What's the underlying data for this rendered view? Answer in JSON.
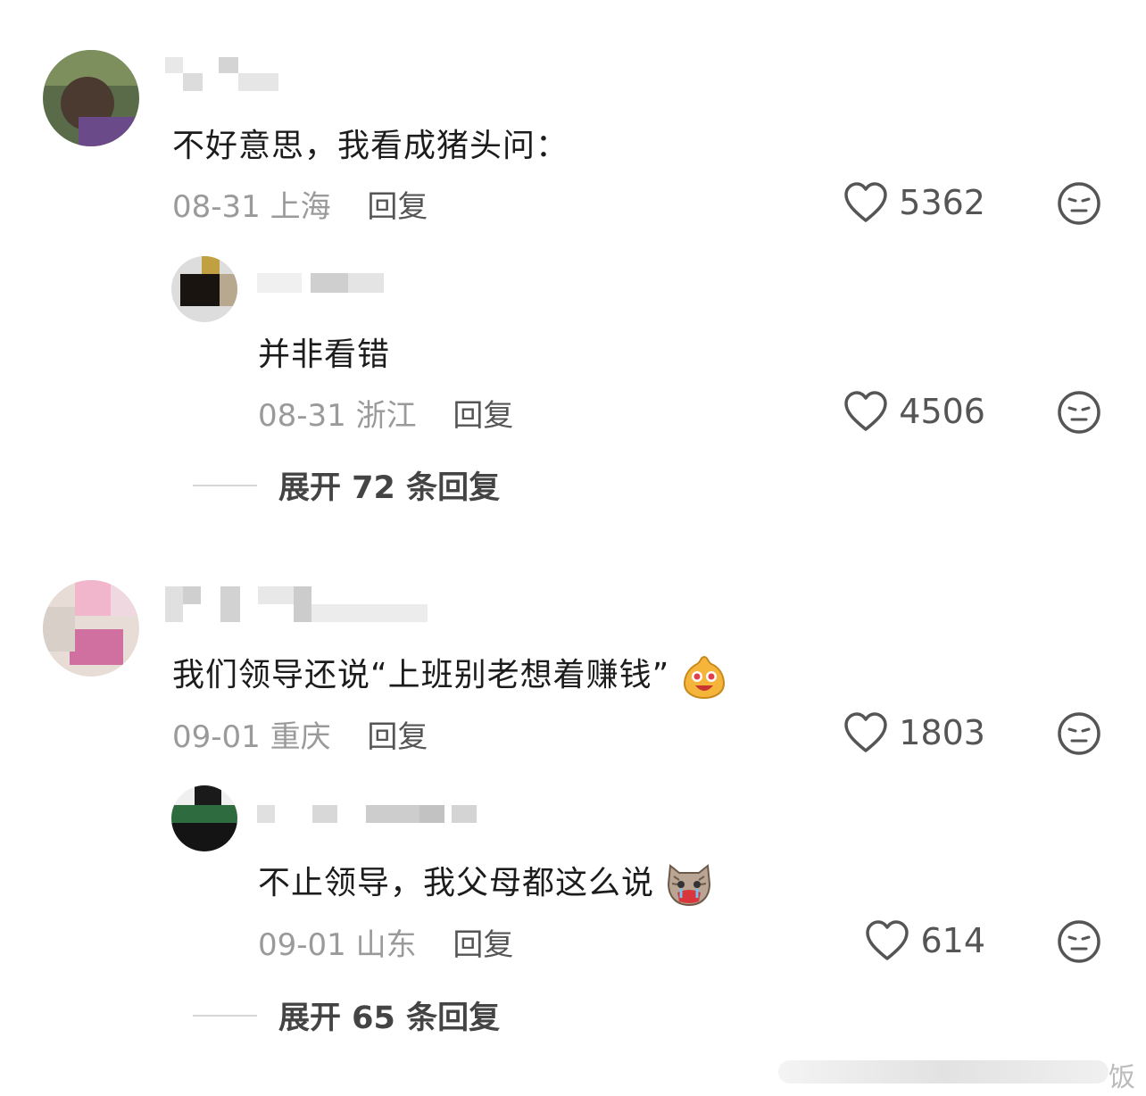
{
  "comments": [
    {
      "text": "不好意思，我看成猪头问：",
      "date": "08-31",
      "location": "上海",
      "reply_label": "回复",
      "likes": "5362",
      "reply": {
        "text": "并非看错",
        "date": "08-31",
        "location": "浙江",
        "reply_label": "回复",
        "likes": "4506"
      },
      "expand_label": "展开 72 条回复"
    },
    {
      "text": "我们领导还说“上班别老想着赚钱”",
      "emoji": "happy-face-emoji",
      "date": "09-01",
      "location": "重庆",
      "reply_label": "回复",
      "likes": "1803",
      "reply": {
        "text": "不止领导，我父母都这么说",
        "emoji": "crying-cat-emoji",
        "date": "09-01",
        "location": "山东",
        "reply_label": "回复",
        "likes": "614"
      },
      "expand_label": "展开 65 条回复"
    }
  ],
  "watermark": "饭"
}
